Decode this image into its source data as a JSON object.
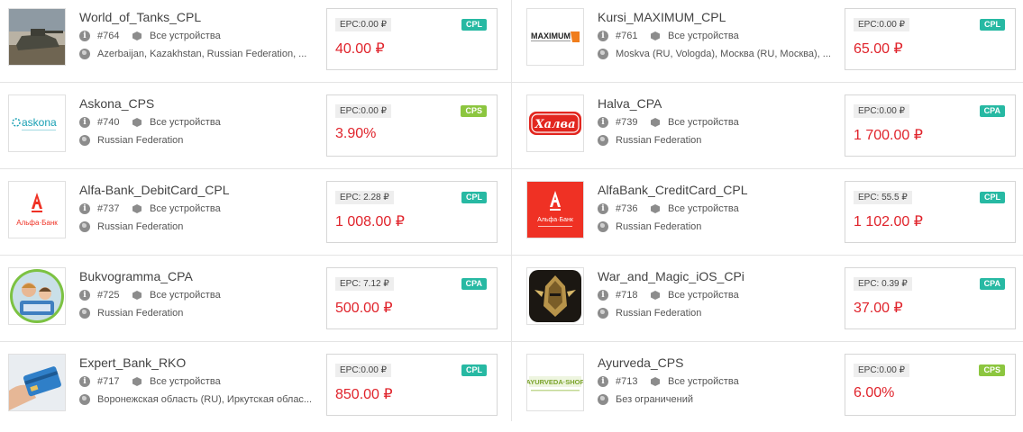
{
  "offers": [
    {
      "name": "World_of_Tanks_CPL",
      "id": "#764",
      "devices": "Все устройства",
      "geo": "Azerbaijan, Kazakhstan, Russian Federation, ...",
      "epc": "EPC:0.00 ₽",
      "type": "CPL",
      "payout": "40.00 ₽",
      "logo": "tank-logo"
    },
    {
      "name": "Kursi_MAXIMUM_CPL",
      "id": "#761",
      "devices": "Все устройства",
      "geo": "Moskva (RU, Vologda), Москва (RU, Москва), ...",
      "epc": "EPC:0.00 ₽",
      "type": "CPL",
      "payout": "65.00 ₽",
      "logo": "maximum-logo",
      "logo_text": "MAXIMUM"
    },
    {
      "name": "Askona_CPS",
      "id": "#740",
      "devices": "Все устройства",
      "geo": "Russian Federation",
      "epc": "EPC:0.00 ₽",
      "type": "CPS",
      "payout": "3.90%",
      "logo": "askona-logo",
      "logo_text": "askona"
    },
    {
      "name": "Halva_CPA",
      "id": "#739",
      "devices": "Все устройства",
      "geo": "Russian Federation",
      "epc": "EPC:0.00 ₽",
      "type": "CPA",
      "payout": "1 700.00 ₽",
      "logo": "halva-logo",
      "logo_text": "Халва"
    },
    {
      "name": "Alfa-Bank_DebitCard_CPL",
      "id": "#737",
      "devices": "Все устройства",
      "geo": "Russian Federation",
      "epc": "EPC: 2.28 ₽",
      "type": "CPL",
      "payout": "1 008.00 ₽",
      "logo": "alfa-bank-logo",
      "logo_text": "Альфа·Банк"
    },
    {
      "name": "AlfaBank_CreditCard_CPL",
      "id": "#736",
      "devices": "Все устройства",
      "geo": "Russian Federation",
      "epc": "EPC: 55.5 ₽",
      "type": "CPL",
      "payout": "1 102.00 ₽",
      "logo": "alfa-bank-red-logo",
      "logo_text": "Альфа·Банк"
    },
    {
      "name": "Bukvogramma_CPA",
      "id": "#725",
      "devices": "Все устройства",
      "geo": "Russian Federation",
      "epc": "EPC: 7.12 ₽",
      "type": "CPA",
      "payout": "500.00 ₽",
      "logo": "children-photo-logo"
    },
    {
      "name": "War_and_Magic_iOS_CPi",
      "id": "#718",
      "devices": "Все устройства",
      "geo": "Russian Federation",
      "epc": "EPC: 0.39 ₽",
      "type": "CPA",
      "payout": "37.00 ₽",
      "logo": "helmet-logo"
    },
    {
      "name": "Expert_Bank_RKO",
      "id": "#717",
      "devices": "Все устройства",
      "geo": "Воронежская область (RU), Иркутская облас...",
      "epc": "EPC:0.00 ₽",
      "type": "CPL",
      "payout": "850.00 ₽",
      "logo": "card-hand-logo"
    },
    {
      "name": "Ayurveda_CPS",
      "id": "#713",
      "devices": "Все устройства",
      "geo": "Без ограничений",
      "epc": "EPC:0.00 ₽",
      "type": "CPS",
      "payout": "6.00%",
      "logo": "ayurveda-logo",
      "logo_text": "AYURVEDA·SHOP"
    }
  ],
  "colors": {
    "payout": "#e0232b",
    "badge_teal": "#27b9a3",
    "badge_green": "#8cc63f"
  }
}
